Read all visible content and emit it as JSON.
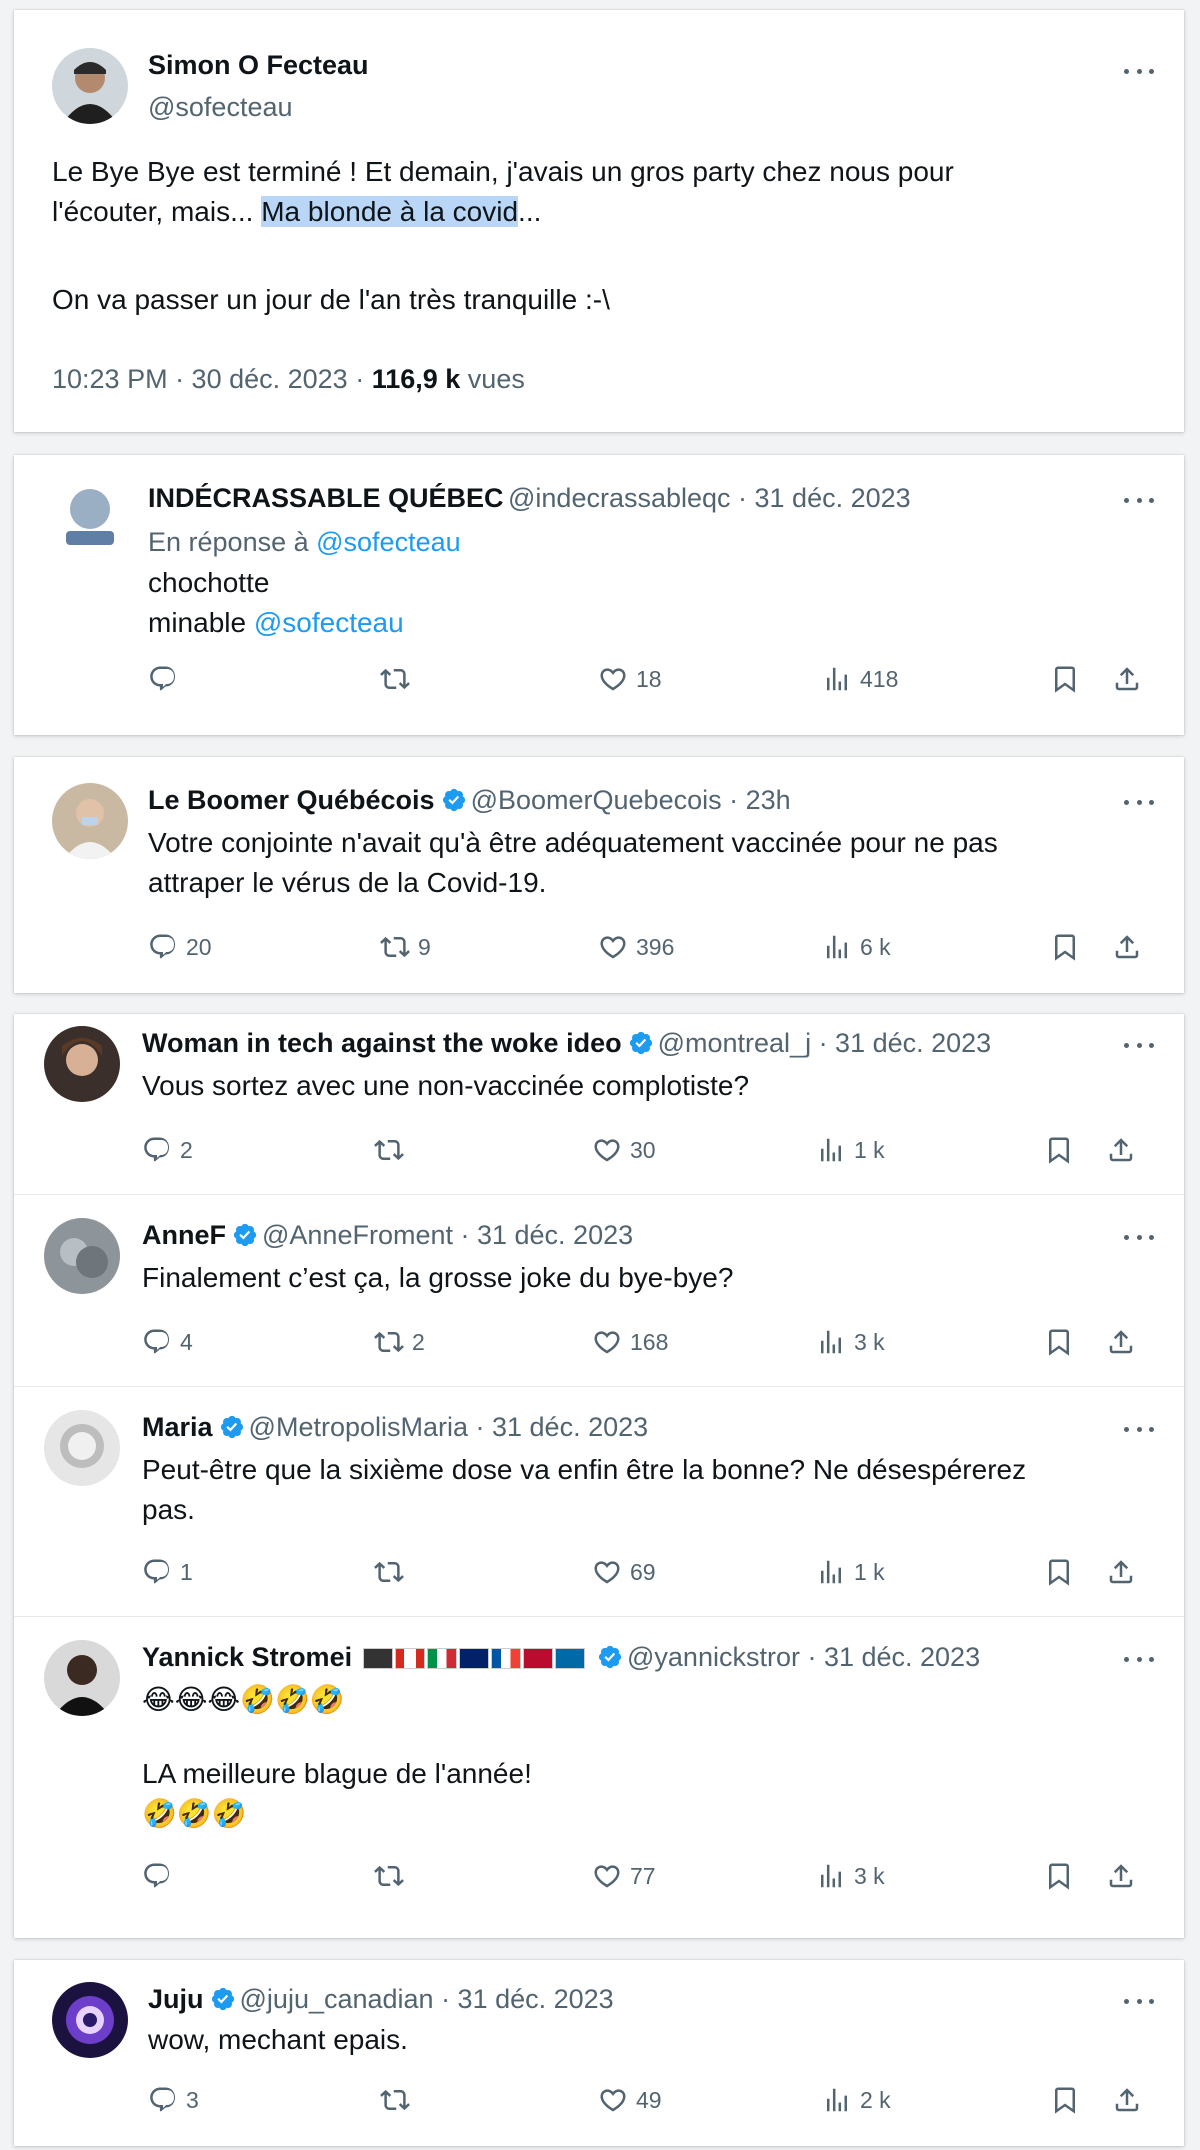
{
  "main_post": {
    "author_name": "Simon O Fecteau",
    "author_handle": "@sofecteau",
    "text_line1": "Le Bye Bye est terminé ! Et demain, j'avais un gros party chez nous pour",
    "text_line2_pre": "l'écouter, mais... ",
    "text_line2_highlight": "Ma blonde à la covid",
    "text_line2_post": "...",
    "text_line3": "On va passer un jour de l'an très tranquille :-\\",
    "time": "10:23 PM · 30 déc. 2023 · ",
    "views_count": "116,9 k",
    "views_label": " vues"
  },
  "replies": [
    {
      "name": "INDÉCRASSABLE QUÉBEC",
      "handle": "@indecrassableqc · 31 déc. 2023",
      "reply_to_label": "En réponse à ",
      "reply_to_handle": "@sofecteau",
      "line1": "chochotte",
      "line2_pre": "minable ",
      "line2_link": "@sofecteau",
      "replies": "",
      "reposts": "",
      "likes": "18",
      "views": "418"
    },
    {
      "name": "Le Boomer Québécois",
      "handle": "@BoomerQuebecois · 23h",
      "line1": "Votre conjointe n'avait qu'à être adéquatement vaccinée pour ne pas",
      "line2": "attraper le vérus de la Covid-19.",
      "replies": "20",
      "reposts": "9",
      "likes": "396",
      "views": "6 k"
    },
    {
      "name": "Woman in tech against the woke ideo",
      "handle": "@montreal_j · 31 déc. 2023",
      "line1": "Vous sortez avec une non-vaccinée complotiste?",
      "replies": "2",
      "reposts": "",
      "likes": "30",
      "views": "1 k"
    },
    {
      "name": "AnneF",
      "handle": "@AnneFroment · 31 déc. 2023",
      "line1": "Finalement c’est ça, la grosse joke du bye-bye?",
      "replies": "4",
      "reposts": "2",
      "likes": "168",
      "views": "3 k"
    },
    {
      "name": "Maria",
      "handle": "@MetropolisMaria · 31 déc. 2023",
      "line1": "Peut-être que la sixième dose va enfin être la bonne? Ne désespérerez",
      "line2": "pas.",
      "replies": "1",
      "reposts": "",
      "likes": "69",
      "views": "1 k"
    },
    {
      "name": "Yannick Stromei",
      "handle": "@yannickstror · 31 déc. 2023",
      "line1": "😂😂😂🤣🤣🤣",
      "line2": "LA meilleure blague de l'année!",
      "line3": "🤣🤣🤣",
      "replies": "",
      "reposts": "",
      "likes": "77",
      "views": "3 k"
    },
    {
      "name": "Juju",
      "handle": "@juju_canadian · 31 déc. 2023",
      "line1": "wow, mechant epais.",
      "replies": "3",
      "reposts": "",
      "likes": "49",
      "views": "2 k"
    }
  ],
  "colors": {
    "link": "#1d9bf0",
    "highlight": "#b9d6f7",
    "muted": "#536471",
    "verified": "#1d9bf0"
  }
}
